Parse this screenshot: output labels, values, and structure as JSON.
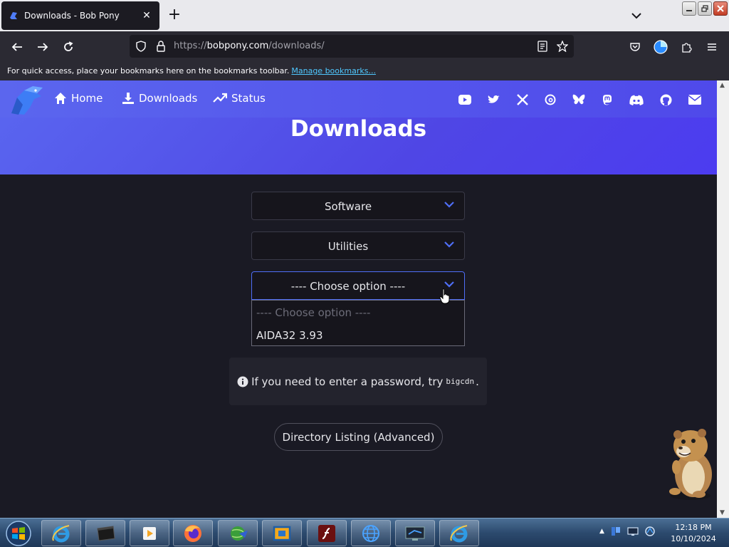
{
  "browser": {
    "tab_title": "Downloads - Bob Pony",
    "url_scheme": "https://",
    "url_host": "bobpony.com",
    "url_path": "/downloads/",
    "bookmarks_hint": "For quick access, place your bookmarks here on the bookmarks toolbar.",
    "bookmarks_link": "Manage bookmarks..."
  },
  "site": {
    "nav": [
      {
        "label": "Home",
        "icon": "home-icon"
      },
      {
        "label": "Downloads",
        "icon": "download-icon"
      },
      {
        "label": "Status",
        "icon": "trending-up-icon"
      }
    ],
    "social_icons": [
      "youtube-icon",
      "twitter-icon",
      "x-icon",
      "threads-icon",
      "bluesky-icon",
      "mastodon-icon",
      "discord-icon",
      "github-icon",
      "email-icon"
    ],
    "accent_color": "#4f46e5",
    "page_title": "Downloads"
  },
  "form": {
    "category_select": "Software",
    "subcategory_select": "Utilities",
    "item_select": "---- Choose option ----",
    "dropdown_options": [
      "---- Choose option ----",
      "AIDA32 3.93"
    ]
  },
  "notice": {
    "text_before": "If you need to enter a password, try",
    "password": "bigcdn",
    "text_after": "."
  },
  "directory_button": "Directory Listing (Advanced)",
  "taskbar": {
    "apps": [
      "internet-explorer-icon",
      "terminal-icon",
      "media-player-icon",
      "firefox-icon",
      "network-globe-icon",
      "virtualbox-icon",
      "flash-icon",
      "globe-icon",
      "remote-desktop-icon",
      "internet-explorer-icon"
    ],
    "time": "12:18 PM",
    "date": "10/10/2024"
  }
}
